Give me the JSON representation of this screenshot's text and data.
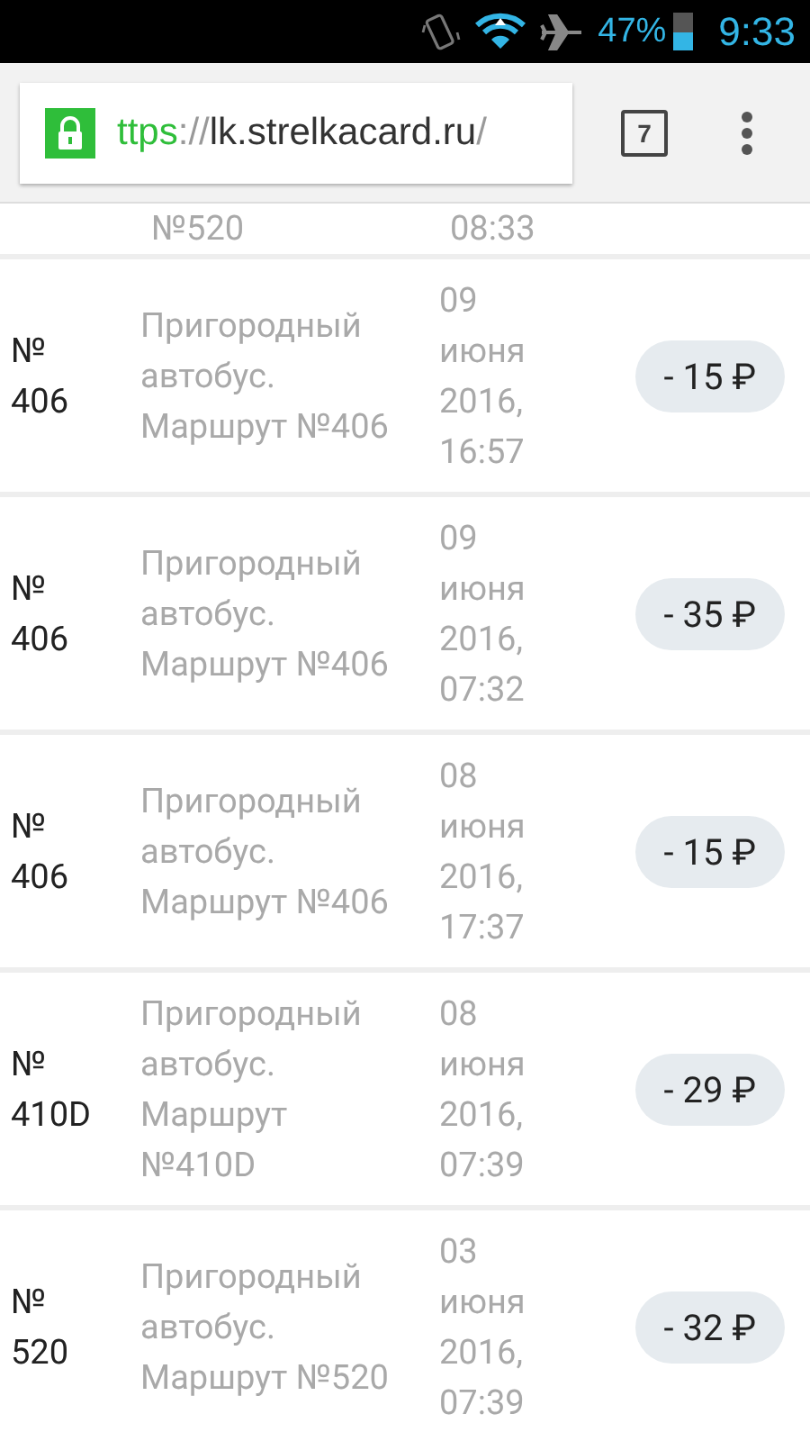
{
  "status_bar": {
    "battery": "47%",
    "time": "9:33"
  },
  "address_bar": {
    "secure": true,
    "url_scheme": "ttps",
    "url_separator": "://",
    "url_host": "lk.strelkacard.ru",
    "url_path": "/"
  },
  "tab_count": "7",
  "partial_row": {
    "description": "№520",
    "date": "08:33"
  },
  "transactions": [
    {
      "number": "№\n406",
      "description": "Пригородный автобус. Маршрут №406",
      "date": "09 июня 2016, 16:57",
      "amount": "- 15 ₽"
    },
    {
      "number": "№\n406",
      "description": "Пригородный автобус. Маршрут №406",
      "date": "09 июня 2016, 07:32",
      "amount": "- 35 ₽"
    },
    {
      "number": "№\n406",
      "description": "Пригородный автобус. Маршрут №406",
      "date": "08 июня 2016, 17:37",
      "amount": "- 15 ₽"
    },
    {
      "number": "№\n410D",
      "description": "Пригородный автобус. Маршрут №410D",
      "date": "08 июня 2016, 07:39",
      "amount": "- 29 ₽"
    },
    {
      "number": "№\n520",
      "description": "Пригородный автобус. Маршрут №520",
      "date": "03 июня 2016, 07:39",
      "amount": "- 32 ₽"
    }
  ]
}
